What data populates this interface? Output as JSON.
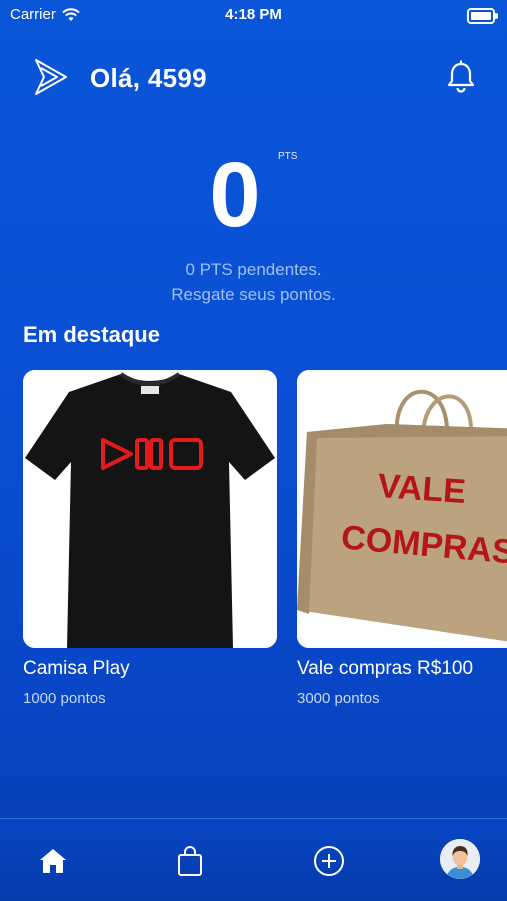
{
  "status_bar": {
    "carrier": "Carrier",
    "time": "4:18 PM"
  },
  "header": {
    "greeting": "Olá, 4599",
    "logo_icon": "play-logo-icon",
    "notification_icon": "bell-icon"
  },
  "points": {
    "value": "0",
    "unit": "PTS",
    "pending_line1": "0 PTS pendentes.",
    "pending_line2": "Resgate seus pontos."
  },
  "featured": {
    "title": "Em destaque",
    "items": [
      {
        "name": "Camisa Play",
        "points": "1000 pontos",
        "image": "tshirt-image"
      },
      {
        "name": "Vale compras R$100",
        "points": "3000 pontos",
        "image": "shopping-bag-image",
        "image_text_1": "VALE",
        "image_text_2": "COMPRAS"
      }
    ]
  },
  "tab_bar": {
    "tabs": [
      {
        "icon": "home-icon",
        "active": true
      },
      {
        "icon": "shopping-bag-icon",
        "active": false
      },
      {
        "icon": "add-circle-icon",
        "active": false
      },
      {
        "icon": "profile-avatar",
        "active": false
      }
    ]
  },
  "colors": {
    "background": "#0a4fd3",
    "accent_red": "#e31b1b",
    "muted_text": "#9fc0f2"
  }
}
